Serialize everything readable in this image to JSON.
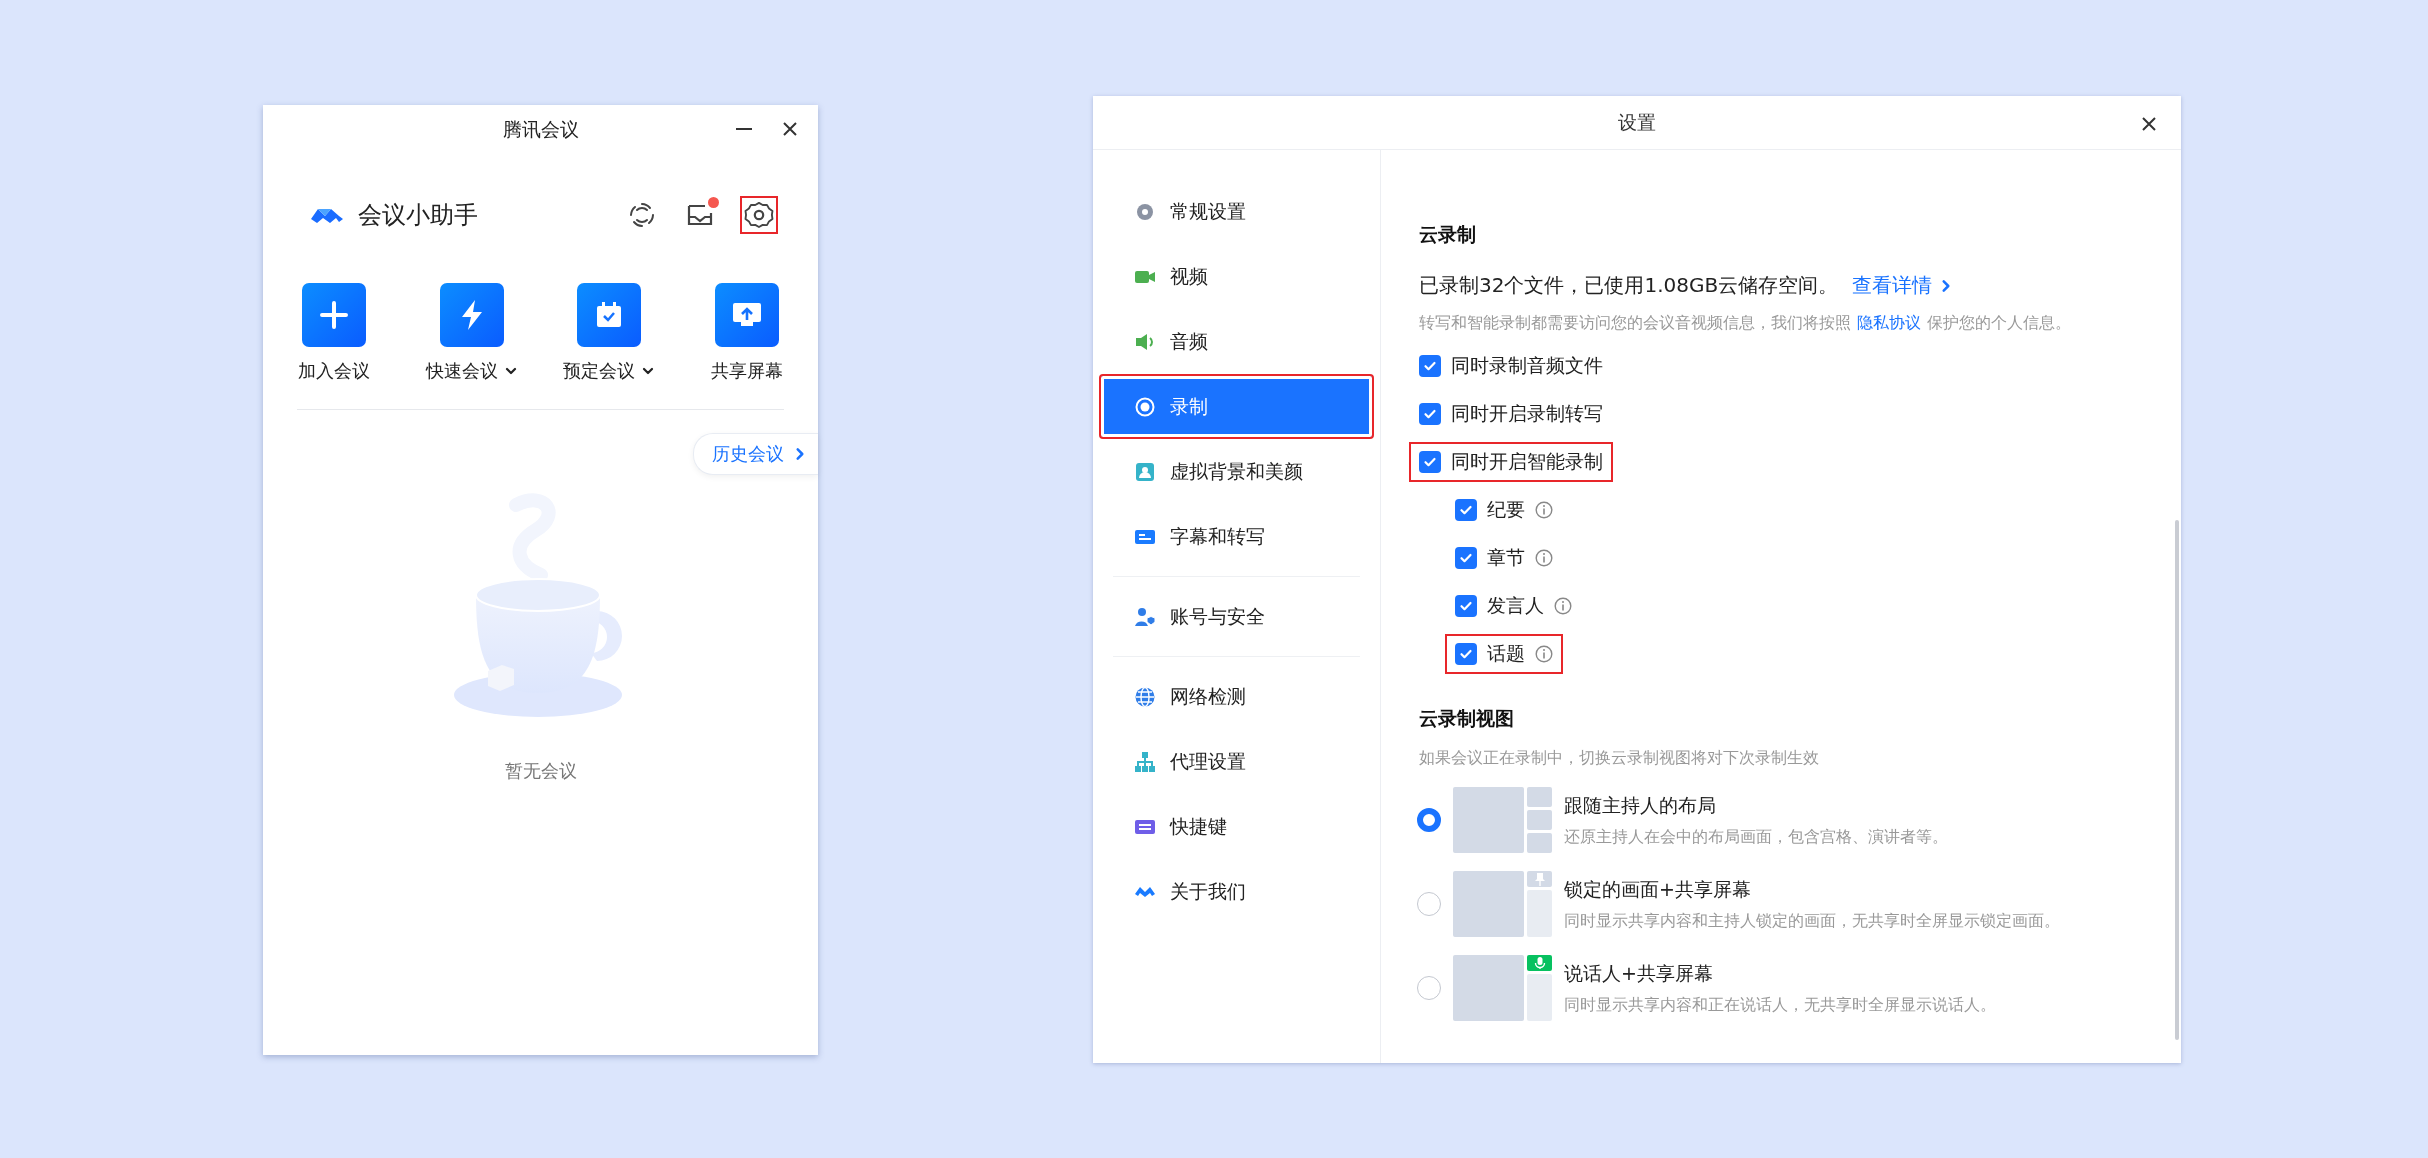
{
  "assistant_window": {
    "title": "腾讯会议",
    "app_name": "会议小助手",
    "inbox_unread": true,
    "settings_highlighted": true,
    "actions": [
      {
        "label": "加入会议",
        "dropdown": false
      },
      {
        "label": "快速会议",
        "dropdown": true
      },
      {
        "label": "预定会议",
        "dropdown": true
      },
      {
        "label": "共享屏幕",
        "dropdown": false
      }
    ],
    "history_button": "历史会议",
    "empty_text": "暂无会议"
  },
  "settings_window": {
    "title": "设置",
    "sidebar": {
      "groups": [
        {
          "items": [
            {
              "label": "常规设置",
              "selected": false,
              "highlighted": false
            },
            {
              "label": "视频",
              "selected": false,
              "highlighted": false
            },
            {
              "label": "音频",
              "selected": false,
              "highlighted": false
            },
            {
              "label": "录制",
              "selected": true,
              "highlighted": true
            },
            {
              "label": "虚拟背景和美颜",
              "selected": false,
              "highlighted": false
            },
            {
              "label": "字幕和转写",
              "selected": false,
              "highlighted": false
            }
          ]
        },
        {
          "items": [
            {
              "label": "账号与安全",
              "selected": false,
              "highlighted": false
            }
          ]
        },
        {
          "items": [
            {
              "label": "网络检测",
              "selected": false,
              "highlighted": false
            },
            {
              "label": "代理设置",
              "selected": false,
              "highlighted": false
            },
            {
              "label": "快捷键",
              "selected": false,
              "highlighted": false
            },
            {
              "label": "关于我们",
              "selected": false,
              "highlighted": false
            }
          ]
        }
      ]
    },
    "cloud_recording": {
      "heading": "云录制",
      "usage": "已录制32个文件，已使用1.08GB云储存空间。",
      "details_link": "查看详情",
      "notice_before": "转写和智能录制都需要访问您的会议音视频信息，我们将按照",
      "privacy_link": "隐私协议",
      "notice_after": "保护您的个人信息。",
      "options": [
        {
          "label": "同时录制音频文件",
          "checked": true,
          "highlighted": false
        },
        {
          "label": "同时开启录制转写",
          "checked": true,
          "highlighted": false
        },
        {
          "label": "同时开启智能录制",
          "checked": true,
          "highlighted": true,
          "children": [
            {
              "label": "纪要",
              "checked": true,
              "highlighted": false
            },
            {
              "label": "章节",
              "checked": true,
              "highlighted": false
            },
            {
              "label": "发言人",
              "checked": true,
              "highlighted": false
            },
            {
              "label": "话题",
              "checked": true,
              "highlighted": true
            }
          ]
        }
      ]
    },
    "recording_view": {
      "heading": "云录制视图",
      "note": "如果会议正在录制中，切换云录制视图将对下次录制生效",
      "layouts": [
        {
          "kind": "grid",
          "title": "跟随主持人的布局",
          "description": "还原主持人在会中的布局画面，包含宫格、演讲者等。",
          "selected": true
        },
        {
          "kind": "pinned",
          "title": "锁定的画面+共享屏幕",
          "description": "同时显示共享内容和主持人锁定的画面，无共享时全屏显示锁定画面。",
          "selected": false
        },
        {
          "kind": "speaker",
          "title": "说话人+共享屏幕",
          "description": "同时显示共享内容和正在说话人，无共享时全屏显示说话人。",
          "selected": false
        }
      ]
    }
  }
}
